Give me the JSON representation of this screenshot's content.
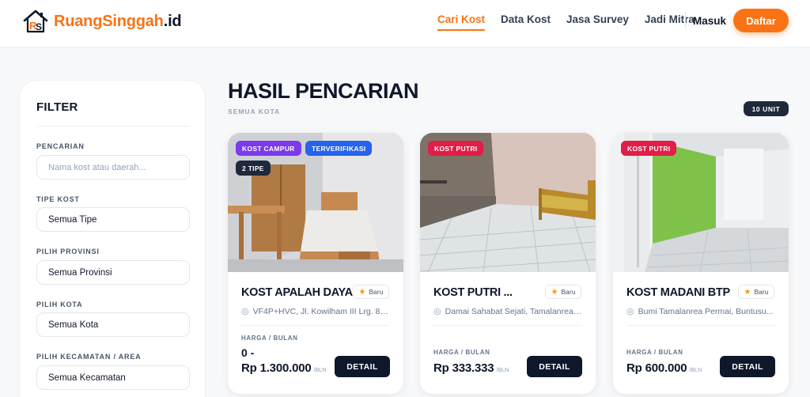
{
  "brand": {
    "part1": "RuangSinggah",
    "part2": ".id"
  },
  "nav": {
    "links": [
      "Cari Kost",
      "Data Kost",
      "Jasa Survey",
      "Jadi Mitra"
    ],
    "login": "Masuk",
    "register": "Daftar"
  },
  "filter": {
    "title": "FILTER",
    "search_label": "PENCARIAN",
    "search_placeholder": "Nama kost atau daerah...",
    "type_label": "TIPE KOST",
    "type_value": "Semua Tipe",
    "province_label": "PILIH PROVINSI",
    "province_value": "Semua Provinsi",
    "city_label": "PILIH KOTA",
    "city_value": "Semua Kota",
    "district_label": "PILIH KECAMATAN / AREA",
    "district_value": "Semua Kecamatan"
  },
  "results": {
    "title": "HASIL PENCARIAN",
    "subtitle": "SEMUA KOTA",
    "count_badge": "10 UNIT"
  },
  "cards": [
    {
      "tags": [
        "KOST CAMPUR",
        "TERVERIFIKASI",
        "2 TIPE"
      ],
      "name": "KOST APALAH DAYA",
      "badge": "Baru",
      "address": "VF4P+HVC, Jl. Kowilham III Lrg. 8, ...",
      "price_label": "HARGA / BULAN",
      "price_prefix": "0 -",
      "price": "Rp 1.300.000",
      "per": "/BLN",
      "button": "DETAIL"
    },
    {
      "tags": [
        "KOST PUTRI"
      ],
      "name": "KOST PUTRI ...",
      "badge": "Baru",
      "address": "Damai Sahabat Sejati, Tamalanrea ...",
      "price_label": "HARGA / BULAN",
      "price": "Rp 333.333",
      "per": "/BLN",
      "button": "DETAIL"
    },
    {
      "tags": [
        "KOST PUTRI"
      ],
      "name": "KOST MADANI BTP",
      "badge": "Baru",
      "address": "Bumi Tamalanrea Permai, Buntusu...",
      "price_label": "HARGA / BULAN",
      "price": "Rp 600.000",
      "per": "/BLN",
      "button": "DETAIL"
    }
  ],
  "icons": {
    "logo": "house-logo-icon",
    "star": "star-icon",
    "pin": "map-pin-icon"
  },
  "colors": {
    "accent": "#f97316",
    "dark": "#0f172a",
    "tag_purple": "#7c3aed",
    "tag_blue": "#2563eb",
    "tag_red": "#e11d48"
  }
}
